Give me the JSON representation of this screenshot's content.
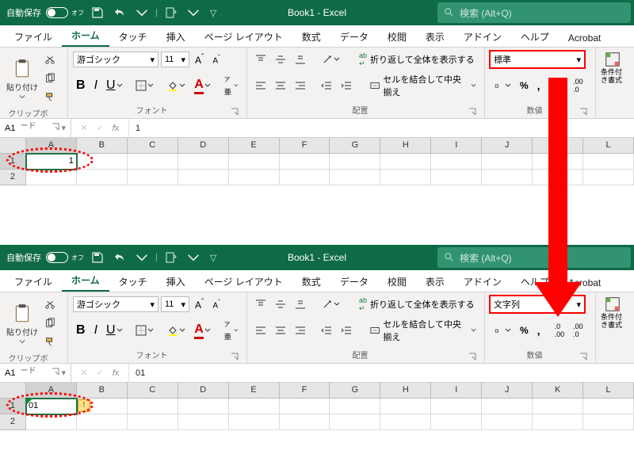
{
  "title_bar": {
    "autosave_label": "自動保存",
    "autosave_state": "オフ",
    "doc_title": "Book1 - Excel",
    "search_placeholder": "検索 (Alt+Q)"
  },
  "menu": {
    "tabs": [
      "ファイル",
      "ホーム",
      "タッチ",
      "挿入",
      "ページ レイアウト",
      "数式",
      "データ",
      "校閲",
      "表示",
      "アドイン",
      "ヘルプ",
      "Acrobat"
    ],
    "active": "ホーム"
  },
  "ribbon": {
    "clipboard": {
      "paste_label": "貼り付け",
      "group_label": "クリップボード"
    },
    "font": {
      "name": "游ゴシック",
      "size": "11",
      "group_label": "フォント"
    },
    "align": {
      "wrap_label": "折り返して全体を表示する",
      "merge_label": "セルを結合して中央揃え",
      "group_label": "配置"
    },
    "number": {
      "group_label": "数値"
    },
    "cond_fmt_label": "条件付き書式"
  },
  "panel1": {
    "number_format": "標準",
    "name_box": "A1",
    "formula_value": "1",
    "cell_value": "1",
    "columns": [
      "A",
      "B",
      "C",
      "D",
      "E",
      "F",
      "G",
      "H",
      "I",
      "J",
      "K",
      "L"
    ],
    "rows": [
      "1",
      "2"
    ]
  },
  "panel2": {
    "number_format": "文字列",
    "name_box": "A1",
    "formula_value": "01",
    "cell_value": "01",
    "columns": [
      "A",
      "B",
      "C",
      "D",
      "E",
      "F",
      "G",
      "H",
      "I",
      "J",
      "K",
      "L"
    ],
    "rows": [
      "1",
      "2"
    ]
  }
}
